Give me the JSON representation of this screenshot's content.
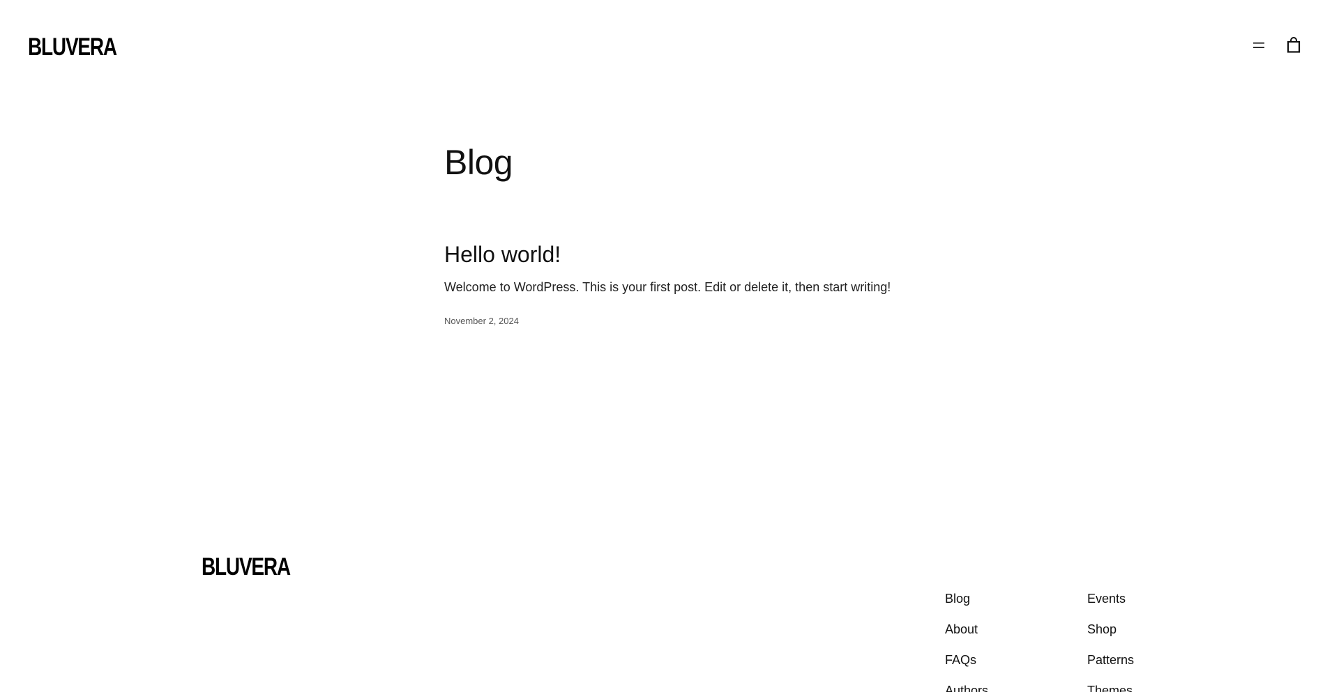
{
  "header": {
    "logo_text": "BLUVERA",
    "menu_icon": "hamburger-menu-icon",
    "cart_icon": "shopping-bag-icon"
  },
  "main": {
    "page_title": "Blog",
    "posts": [
      {
        "title": "Hello world!",
        "excerpt": "Welcome to WordPress. This is your first post. Edit or delete it, then start writing!",
        "date": "November 2, 2024"
      }
    ]
  },
  "footer": {
    "logo_text": "BLUVERA",
    "links": [
      {
        "label": "Blog"
      },
      {
        "label": "Events"
      },
      {
        "label": "About"
      },
      {
        "label": "Shop"
      },
      {
        "label": "FAQs"
      },
      {
        "label": "Patterns"
      },
      {
        "label": "Authors"
      },
      {
        "label": "Themes"
      }
    ]
  }
}
